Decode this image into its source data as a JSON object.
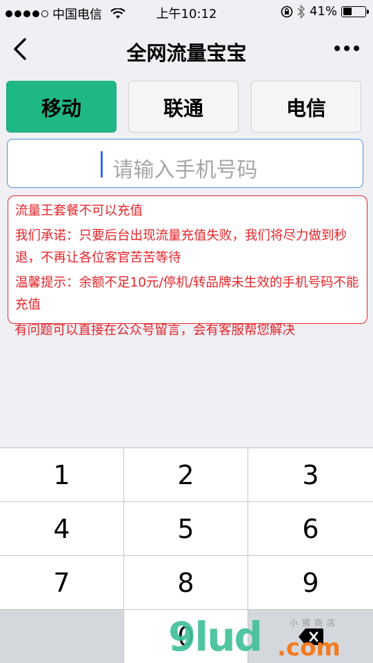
{
  "status_bar": {
    "carrier": "中国电信",
    "time": "上午10:12",
    "battery": "41%",
    "battery_level": 0.41
  },
  "nav": {
    "title": "全网流量宝宝"
  },
  "tabs": [
    {
      "label": "移动",
      "active": true
    },
    {
      "label": "联通",
      "active": false
    },
    {
      "label": "电信",
      "active": false
    }
  ],
  "phone_input": {
    "placeholder": "请输入手机号码",
    "value": ""
  },
  "notice": {
    "line1": "流量王套餐不可以充值",
    "line2": "我们承诺：只要后台出现流量充值失败，我们将尽力做到秒退，不再让各位客官苦苦等待",
    "line3": "温馨提示：余额不足10元/停机/转品牌未生效的手机号码不能充值",
    "line4": "有问题可以直接在公众号留言，会有客服帮您解决"
  },
  "keypad": {
    "keys": [
      "1",
      "2",
      "3",
      "4",
      "5",
      "6",
      "7",
      "8",
      "9",
      "",
      "0",
      "delete"
    ]
  },
  "watermark": {
    "brand": "9lud",
    "suffix": ".com",
    "tagline": "小猪商店"
  },
  "colors": {
    "accent_green": "#1fb884",
    "notice_red": "#e5252a",
    "input_border": "#4a90e2"
  }
}
